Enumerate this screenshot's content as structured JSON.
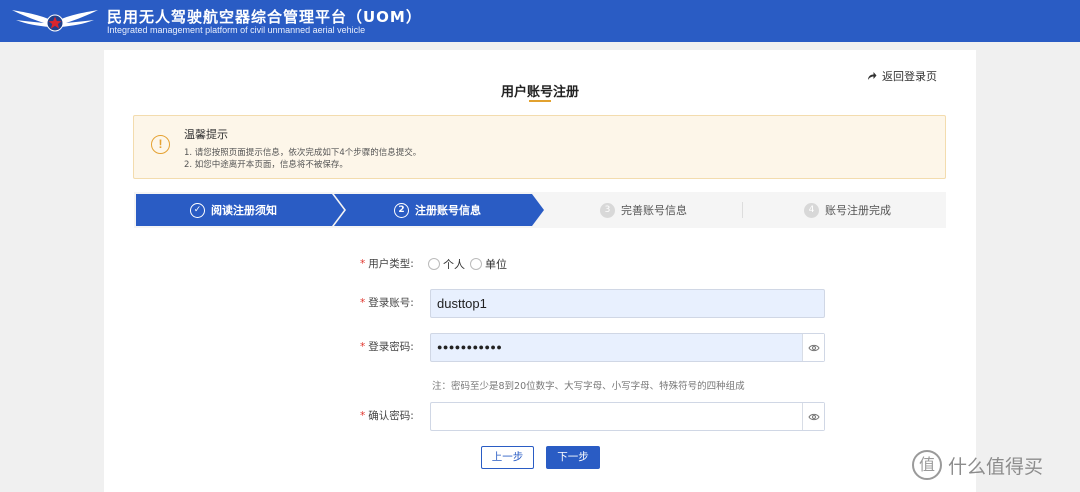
{
  "header": {
    "title": "民用无人驾驶航空器综合管理平台（UOM）",
    "subtitle": "Integrated management platform of civil unmanned aerial vehicle",
    "logo_icon": "wings-star-emblem-icon"
  },
  "page": {
    "back_link": "返回登录页",
    "title": "用户账号注册"
  },
  "notice": {
    "title": "温馨提示",
    "lines": [
      "1. 请您按照页面提示信息，依次完成如下4个步骤的信息提交。",
      "2. 如您中途离开本页面，信息将不被保存。"
    ]
  },
  "steps": [
    {
      "number": "✓",
      "label": "阅读注册须知",
      "status": "done"
    },
    {
      "number": "2",
      "label": "注册账号信息",
      "status": "current"
    },
    {
      "number": "3",
      "label": "完善账号信息",
      "status": "pending"
    },
    {
      "number": "4",
      "label": "账号注册完成",
      "status": "pending"
    }
  ],
  "form": {
    "user_type": {
      "label": "用户类型:",
      "options": [
        "个人",
        "单位"
      ],
      "selected": null
    },
    "account": {
      "label": "登录账号:",
      "value": "dusttop1"
    },
    "password": {
      "label": "登录密码:",
      "value": "●●●●●●●●●●●"
    },
    "password_hint": "注：密码至少是8到20位数字、大写字母、小写字母、特殊符号的四种组成",
    "confirm_password": {
      "label": "确认密码:",
      "value": ""
    },
    "required_mark": "*"
  },
  "buttons": {
    "prev": "上一步",
    "next": "下一步"
  },
  "watermark": {
    "badge": "值",
    "text": "什么值得买"
  },
  "colors": {
    "primary": "#2a5cc4",
    "warning": "#e5a233",
    "notice_bg": "#fdf6e9",
    "required": "#e0342c",
    "filled_input_bg": "#e8f0fe"
  }
}
